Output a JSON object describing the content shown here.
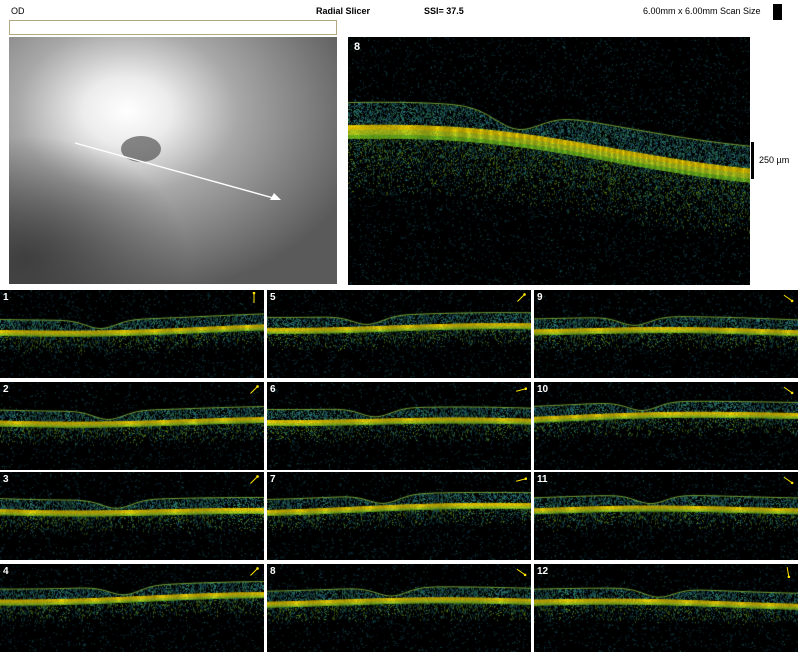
{
  "header": {
    "eye": "OD",
    "title": "Radial Slicer",
    "ssi": "SSI= 37.5",
    "scan_size": "6.00mm x 6.00mm Scan Size"
  },
  "main_scan": {
    "number": "8",
    "scale_label": "250 µm"
  },
  "scans": [
    {
      "number": "1",
      "icon": "arrow-up-icon"
    },
    {
      "number": "2",
      "icon": "arrow-up-right-icon"
    },
    {
      "number": "3",
      "icon": "arrow-up-right-icon"
    },
    {
      "number": "4",
      "icon": "arrow-up-right-icon"
    },
    {
      "number": "5",
      "icon": "arrow-up-right-icon"
    },
    {
      "number": "6",
      "icon": "arrow-right-icon"
    },
    {
      "number": "7",
      "icon": "arrow-right-icon"
    },
    {
      "number": "8",
      "icon": "arrow-down-right-icon"
    },
    {
      "number": "9",
      "icon": "arrow-down-right-icon"
    },
    {
      "number": "10",
      "icon": "arrow-down-right-icon"
    },
    {
      "number": "11",
      "icon": "arrow-down-right-icon"
    },
    {
      "number": "12",
      "icon": "arrow-down-icon"
    }
  ],
  "colors": {
    "background": "#ffffff",
    "scan_background": "#000000",
    "retina_bright": "#ffe000",
    "retina_mid": "#8fd21a",
    "retina_noise": "#2a7a9a",
    "label_text": "#ffffff",
    "arrow": "#ffe600"
  }
}
